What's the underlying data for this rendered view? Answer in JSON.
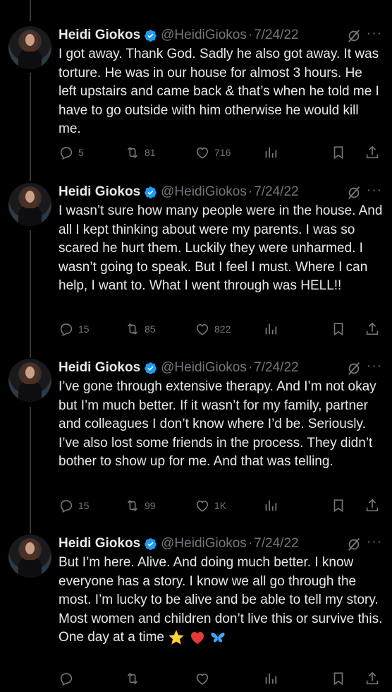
{
  "author": {
    "name": "Heidi Giokos",
    "handle": "@HeidiGiokos",
    "separator": "·",
    "date": "7/24/22",
    "more_label": "···"
  },
  "icons": {
    "verified": "verified-badge-icon",
    "grok": "grok-icon",
    "reply": "reply-icon",
    "retweet": "retweet-icon",
    "like": "heart-icon",
    "views": "views-icon",
    "bookmark": "bookmark-icon",
    "share": "share-icon"
  },
  "colors": {
    "verified": "#1d9bf0",
    "muted": "#71767b",
    "text": "#e7e9ea"
  },
  "tweets": [
    {
      "text": "I got away. Thank God. Sadly he also got away. It was torture. He was in our house for almost 3 hours. He left upstairs and came back & that’s when he told me I have to go outside with him otherwise he would kill me.",
      "replies": "5",
      "retweets": "81",
      "likes": "716"
    },
    {
      "text": "I wasn’t sure how many people were in the house. And all I kept thinking about were my parents. I was so scared he hurt them. Luckily they were unharmed. I wasn’t going to speak. But I feel I must. Where I can help, I want to. What I went through was HELL!!",
      "replies": "15",
      "retweets": "85",
      "likes": "822"
    },
    {
      "text": "I’ve gone through extensive therapy. And I’m not okay but I’m much better. If it wasn’t for my family, partner and colleagues I don’t know where I’d be. Seriously. I’ve also lost some friends in the process. They didn’t bother to show up for me. And that was telling.",
      "replies": "15",
      "retweets": "99",
      "likes": "1K"
    },
    {
      "text": "But I’m here. Alive. And doing much better. I know everyone has a story. I know we all go through the most. I’m lucky to be alive and be able to tell my story. Most women and children don’t live this or survive this.",
      "last_line": "One day at a time",
      "emojis": [
        "star-emoji",
        "red-heart-emoji",
        "butterfly-emoji"
      ]
    }
  ]
}
